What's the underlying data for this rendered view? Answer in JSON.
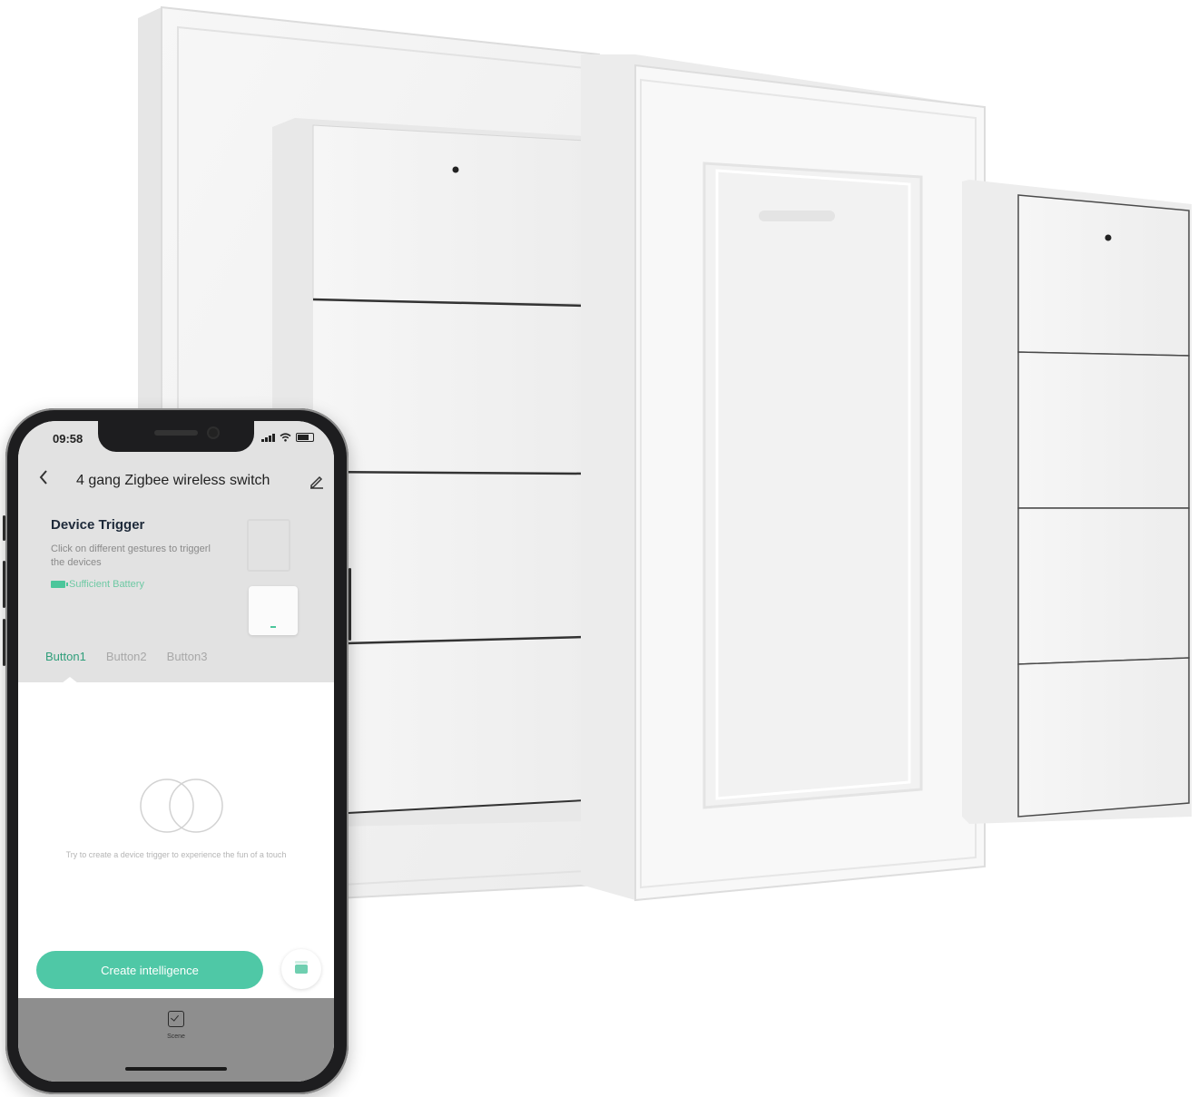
{
  "status_bar": {
    "time": "09:58"
  },
  "header": {
    "back_icon": "chevron-left-icon",
    "title": "4 gang Zigbee wireless switch",
    "edit_icon": "pencil-icon"
  },
  "device_trigger": {
    "title": "Device Trigger",
    "description": "Click on different gestures to triggerl the devices",
    "battery_status": "Sufficient Battery"
  },
  "tabs": [
    {
      "label": "Button1",
      "active": true
    },
    {
      "label": "Button2",
      "active": false
    },
    {
      "label": "Button3",
      "active": false
    }
  ],
  "empty_state": {
    "message": "Try to create a device trigger to experience the fun of a touch"
  },
  "actions": {
    "create_label": "Create intelligence"
  },
  "bottom_nav": {
    "scene_label": "Scene"
  },
  "colors": {
    "accent": "#4fc8a6",
    "tab_active": "#2f9e7a",
    "battery_green": "#4bc69b"
  }
}
